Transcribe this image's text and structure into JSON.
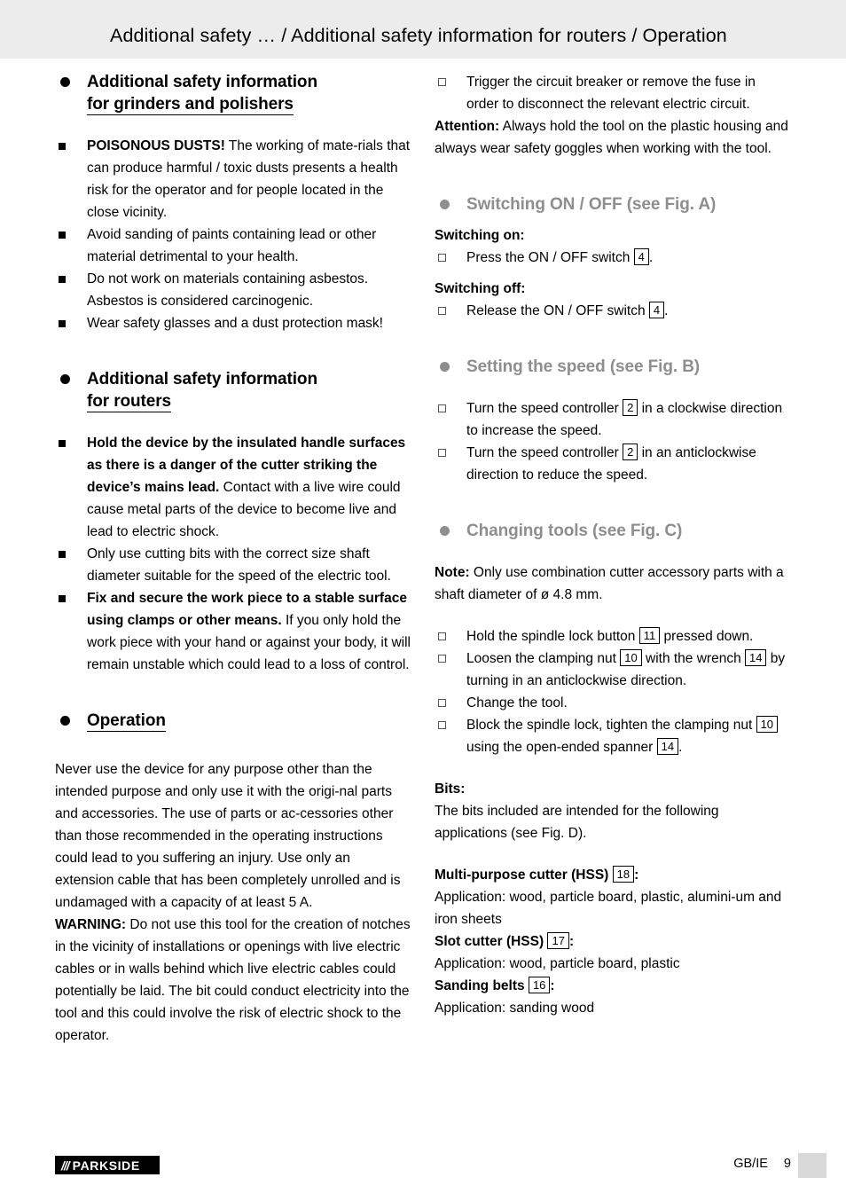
{
  "header": {
    "title": "Additional safety … / Additional safety information for routers / Operation"
  },
  "left_column": {
    "section1": {
      "heading_line1": "Additional safety information",
      "heading_line2": "for grinders and polishers",
      "items": [
        {
          "bold": "POISONOUS DUSTS!",
          "text": " The working of mate-rials that can produce harmful / toxic dusts presents a health risk for the operator and for people located in the close vicinity."
        },
        {
          "bold": "",
          "text": "Avoid sanding of paints containing lead or other material detrimental to your health."
        },
        {
          "bold": "",
          "text": "Do not work on materials containing asbestos. Asbestos is considered carcinogenic."
        },
        {
          "bold": "",
          "text": "Wear safety glasses and a dust protection mask!"
        }
      ]
    },
    "section2": {
      "heading_line1": "Additional safety information",
      "heading_line2": "for routers",
      "items": [
        {
          "bold": "Hold the device by the insulated handle surfaces as there is a danger of the cutter striking the device’s mains lead.",
          "text": " Contact with a live wire could cause metal parts of the device to become live and lead to electric shock."
        },
        {
          "bold": "",
          "text": "Only use cutting bits with the correct size shaft diameter suitable for the speed of the electric tool."
        },
        {
          "bold": "Fix and secure the work piece to a stable surface using clamps or other means.",
          "text": " If you only hold the work piece with your hand or against your body, it will remain unstable which could lead to a loss of control."
        }
      ]
    },
    "section3": {
      "heading": "Operation",
      "paragraph1": "Never use the device for any purpose other than the intended purpose and only use it with the origi-nal parts and accessories. The use of parts or ac-cessories other than those recommended in the operating instructions could lead to you suffering an injury. Use only an extension cable that has been completely unrolled and is undamaged with a capacity of at least 5 A.",
      "warning_label": "WARNING:",
      "warning_text": " Do not use this tool for the creation of notches in the vicinity of installations or openings with live electric cables or in walls behind which live electric cables could potentially be laid. The bit could conduct electricity into the tool and this could involve the risk of electric shock to the operator."
    }
  },
  "right_column": {
    "top_item": "Trigger the circuit breaker or remove the fuse in order to disconnect the relevant electric circuit.",
    "attention_label": "Attention:",
    "attention_text": " Always hold the tool on the plastic housing and always wear safety goggles when working with the tool.",
    "section_switching": {
      "heading": "Switching ON / OFF (see Fig. A)",
      "on_label": "Switching on:",
      "on_item_pre": "Press the ON / OFF switch",
      "on_item_ref": "4",
      "on_item_post": ".",
      "off_label": "Switching off:",
      "off_item_pre": "Release the ON / OFF switch",
      "off_item_ref": "4",
      "off_item_post": "."
    },
    "section_speed": {
      "heading": "Setting the speed (see Fig. B)",
      "items": [
        {
          "pre": "Turn the speed controller",
          "ref": "2",
          "post": " in a clockwise direction to increase the speed."
        },
        {
          "pre": "Turn the speed controller",
          "ref": "2",
          "post": " in an anticlockwise direction to reduce the speed."
        }
      ]
    },
    "section_changing": {
      "heading": "Changing tools (see Fig. C)",
      "note_label": "Note:",
      "note_text": " Only use combination cutter accessory parts with a shaft diameter of ø 4.8 mm.",
      "items": [
        {
          "pre": "Hold the spindle lock button",
          "ref": "11",
          "post": " pressed down.",
          "ref2": "",
          "post2": ""
        },
        {
          "pre": "Loosen the clamping nut",
          "ref": "10",
          "post": " with the wrench",
          "ref2": "14",
          "post2": " by turning in an anticlockwise direction."
        },
        {
          "pre": "Change the tool.",
          "ref": "",
          "post": "",
          "ref2": "",
          "post2": ""
        },
        {
          "pre": "Block the spindle lock, tighten the clamping nut",
          "ref": "10",
          "post": " using the open-ended spanner",
          "ref2": "14",
          "post2": "."
        }
      ],
      "bits_label": "Bits:",
      "bits_text": "The bits included are intended for the following applications (see Fig. D).",
      "bit_entries": [
        {
          "title": "Multi-purpose cutter (HSS)",
          "ref": "18",
          "colon": ":",
          "application": "Application: wood, particle board, plastic, alumini-um and iron sheets"
        },
        {
          "title": "Slot cutter (HSS)",
          "ref": "17",
          "colon": ":",
          "application": "Application: wood, particle board, plastic"
        },
        {
          "title": "Sanding belts",
          "ref": "16",
          "colon": ":",
          "application": "Application: sanding wood"
        }
      ]
    }
  },
  "footer": {
    "brand_slashes": "///",
    "brand": "PARKSIDE",
    "locale": "GB/IE",
    "page_number": "9"
  }
}
